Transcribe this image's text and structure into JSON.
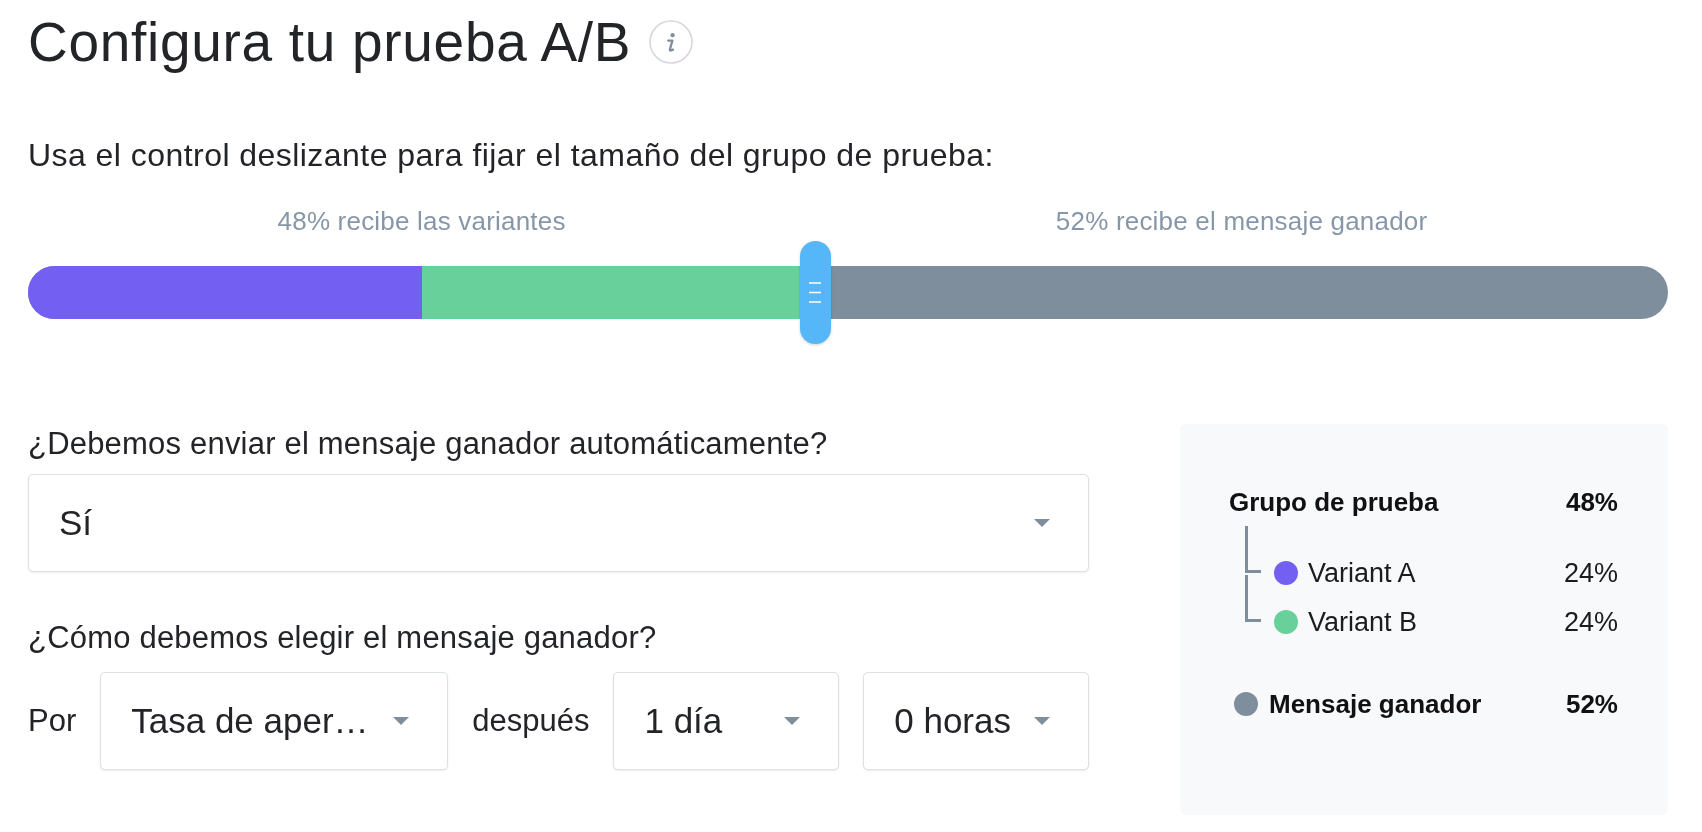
{
  "header": {
    "title": "Configura tu prueba A/B"
  },
  "split": {
    "instruction": "Usa el control deslizante para fijar el tamaño del grupo de prueba:",
    "left_label": "48% recibe las variantes",
    "right_label": "52% recibe el mensaje ganador",
    "level": 0.48,
    "segments": [
      {
        "color": "#7360f2"
      },
      {
        "color": "#68d09b"
      }
    ]
  },
  "auto_send": {
    "question": "¿Debemos enviar el mensaje ganador automáticamente?",
    "value": "Sí"
  },
  "winner_rule": {
    "question": "¿Cómo debemos elegir el mensaje ganador?",
    "items": [
      {
        "kind": "text",
        "text": "Por"
      },
      {
        "kind": "select",
        "value": "Tasa de aper…"
      },
      {
        "kind": "text",
        "text": "después"
      },
      {
        "kind": "select",
        "value": "1 día"
      },
      {
        "kind": "select",
        "value": "0 horas"
      }
    ]
  },
  "summary": {
    "groups": [
      {
        "label": "Grupo de prueba",
        "value": "48%",
        "children": [
          {
            "label": "Variant A",
            "value": "24%",
            "color": "#7360f2"
          },
          {
            "label": "Variant B",
            "value": "24%",
            "color": "#68d09b"
          }
        ]
      },
      {
        "label": "Mensaje ganador",
        "value": "52%",
        "color": "#7f8e9d"
      }
    ]
  }
}
